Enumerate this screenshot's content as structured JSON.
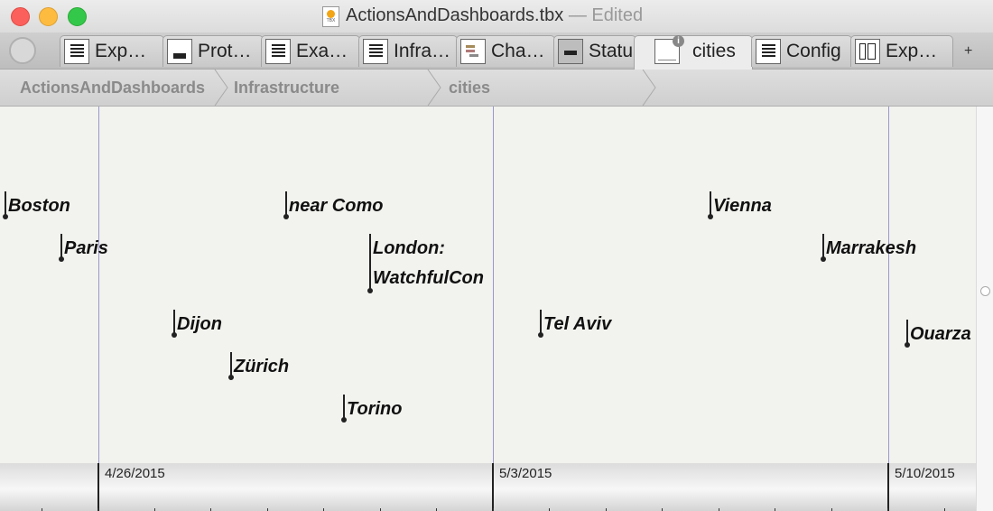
{
  "window": {
    "title": "ActionsAndDashboards.tbx",
    "separator": "—",
    "status": "Edited",
    "doc_icon_text": "TBX"
  },
  "tabs": [
    {
      "label": "Exp…",
      "icon": "lines-icon"
    },
    {
      "label": "Prot…",
      "icon": "bar-icon"
    },
    {
      "label": "Exa…",
      "icon": "lines-icon"
    },
    {
      "label": "Infra…",
      "icon": "lines-icon"
    },
    {
      "label": "Cha…",
      "icon": "chart-icon"
    },
    {
      "label": "Statu",
      "icon": "status-icon"
    },
    {
      "label": "cities",
      "icon": "timeline-icon",
      "active": true
    },
    {
      "label": "Config",
      "icon": "lines-icon"
    },
    {
      "label": "Exp…",
      "icon": "grid-icon"
    }
  ],
  "tab_add_label": "+",
  "info_badge": "i",
  "breadcrumb": [
    "ActionsAndDashboards",
    "Infrastructure",
    "cities"
  ],
  "timeline": {
    "axis_labels": [
      "4/26/2015",
      "5/3/2015",
      "5/10/2015"
    ],
    "events": [
      {
        "label": "Boston",
        "lines": 1
      },
      {
        "label": "Paris",
        "lines": 1
      },
      {
        "label": "near Como",
        "lines": 1
      },
      {
        "label": "London:",
        "label2": "WatchfulCon",
        "lines": 2
      },
      {
        "label": "Dijon",
        "lines": 1
      },
      {
        "label": "Zürich",
        "lines": 1
      },
      {
        "label": "Torino",
        "lines": 1
      },
      {
        "label": "Tel Aviv",
        "lines": 1
      },
      {
        "label": "Vienna",
        "lines": 1
      },
      {
        "label": "Marrakesh",
        "lines": 1
      },
      {
        "label": "Ouarza",
        "lines": 1
      }
    ]
  },
  "colors": {
    "close": "#fc605c",
    "minimize": "#fdbc40",
    "maximize": "#34c84a",
    "week_line": "#9999cc"
  }
}
